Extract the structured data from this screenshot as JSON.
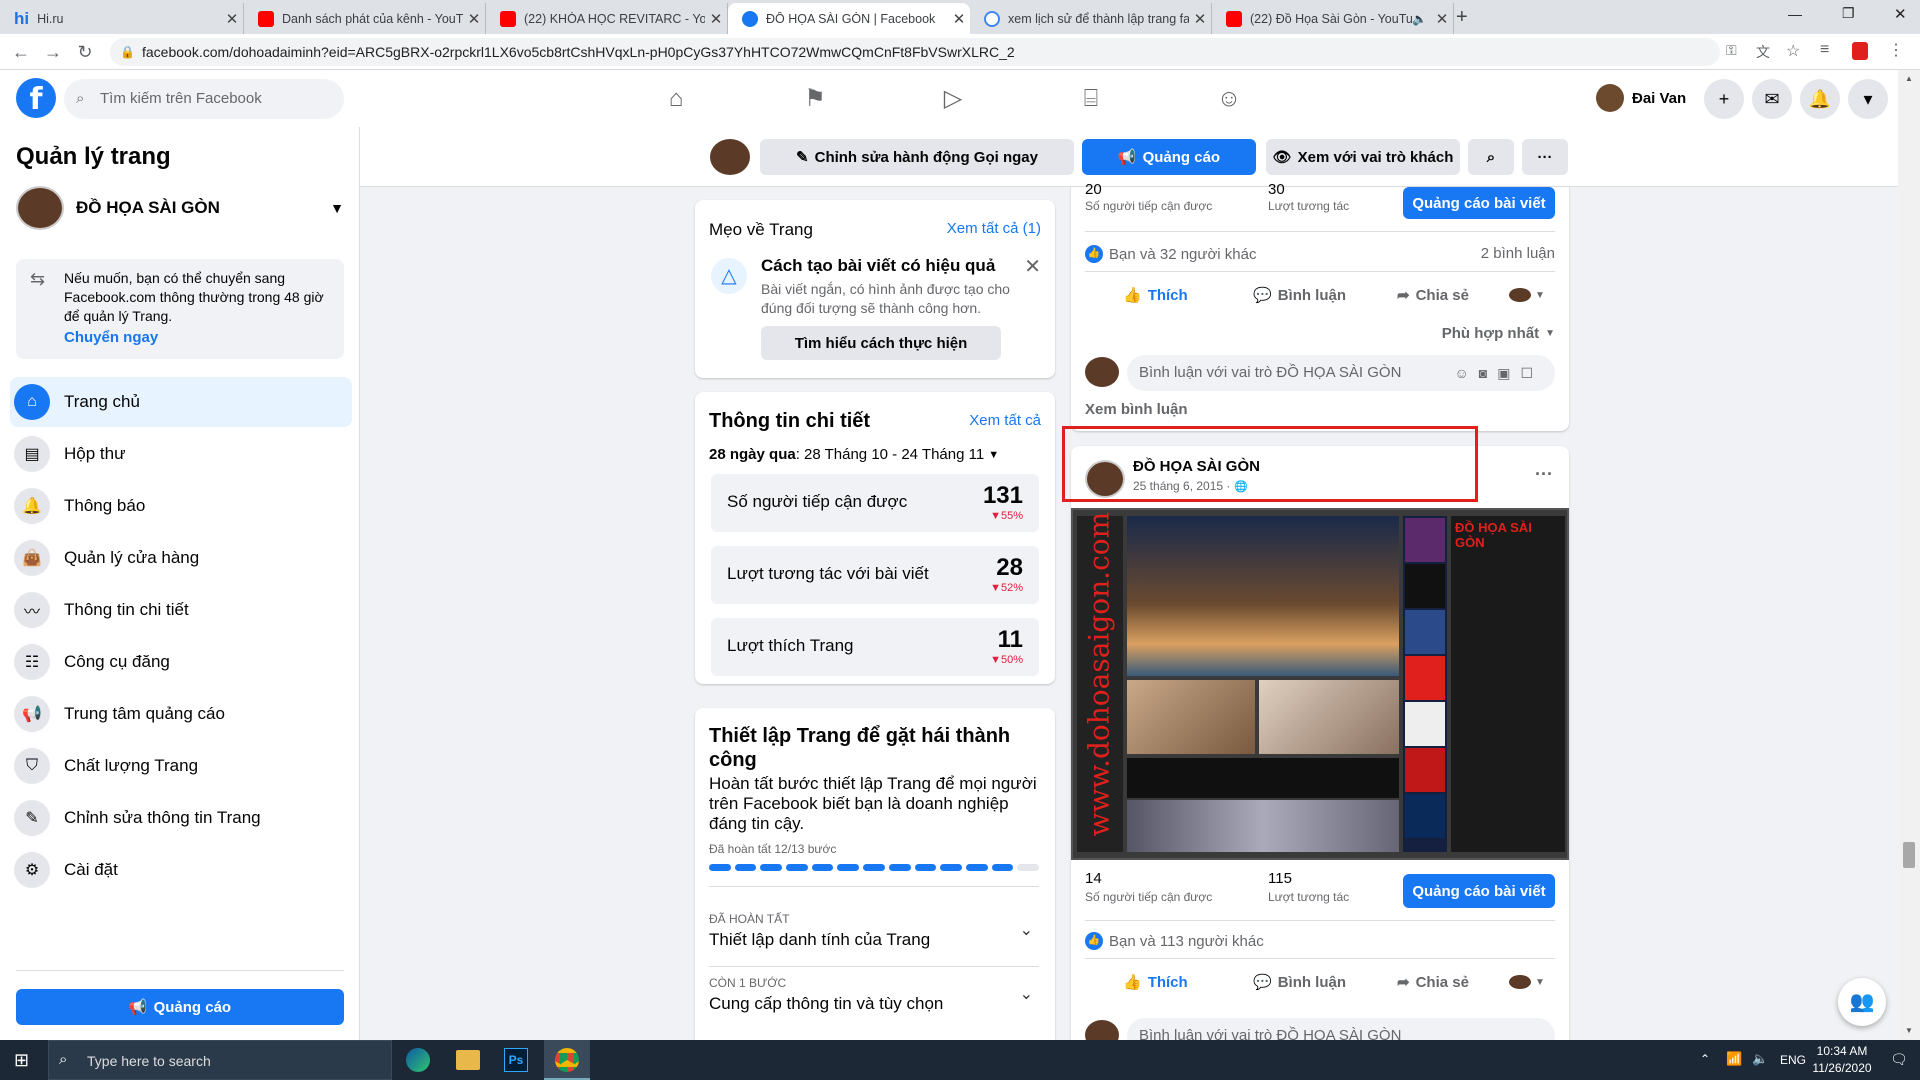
{
  "browser": {
    "tabs": [
      {
        "label": "Hi.ru",
        "favicon_text": "hi"
      },
      {
        "label": "Danh sách phát của kênh - YouTu"
      },
      {
        "label": "(22) KHÓA HỌC REVITARC - YouT"
      },
      {
        "label": "ĐỒ HỌA SÀI GÒN | Facebook"
      },
      {
        "label": "xem lịch sử để thành lập trang fa"
      },
      {
        "label": "(22) Đồ Họa Sài Gòn - YouTu"
      }
    ],
    "url": "facebook.com/dohoadaiminh?eid=ARC5gBRX-o2rpckrl1LX6vo5cb8rtCshHVqxLn-pH0pCyGs37YhHTCO72WmwCQmCnFt8FbVSwrXLRC_2"
  },
  "header": {
    "search_placeholder": "Tìm kiếm trên Facebook",
    "user_name": "Đai Van"
  },
  "sidebar": {
    "title": "Quản lý trang",
    "page_name": "ĐỒ HỌA SÀI GÒN",
    "notice": "Nếu muốn, bạn có thể chuyển sang Facebook.com thông thường trong 48 giờ để quản lý Trang.",
    "notice_link": "Chuyển ngay",
    "items": [
      {
        "label": "Trang chủ"
      },
      {
        "label": "Hộp thư"
      },
      {
        "label": "Thông báo"
      },
      {
        "label": "Quản lý cửa hàng"
      },
      {
        "label": "Thông tin chi tiết"
      },
      {
        "label": "Công cụ đăng"
      },
      {
        "label": "Trung tâm quảng cáo"
      },
      {
        "label": "Chất lượng Trang"
      },
      {
        "label": "Chỉnh sửa thông tin Trang"
      },
      {
        "label": "Cài đặt"
      }
    ],
    "ad_button": "Quảng cáo"
  },
  "pagebar": {
    "edit_action": "Chỉnh sửa hành động Gọi ngay",
    "ad": "Quảng cáo",
    "view_as": "Xem với vai trò khách"
  },
  "tips": {
    "title": "Mẹo về Trang",
    "see_all": "Xem tất cả (1)",
    "tip_title": "Cách tạo bài viết có hiệu quả",
    "tip_body": "Bài viết ngắn, có hình ảnh được tạo cho đúng đối tượng sẽ thành công hơn.",
    "tip_button": "Tìm hiểu cách thực hiện"
  },
  "insights": {
    "title": "Thông tin chi tiết",
    "see_all": "Xem tất cả",
    "range_prefix": "28 ngày qua",
    "range": ": 28 Tháng 10 - 24 Tháng 11",
    "stats": [
      {
        "label": "Số người tiếp cận được",
        "value": "131",
        "change": "55%"
      },
      {
        "label": "Lượt tương tác với bài viết",
        "value": "28",
        "change": "52%"
      },
      {
        "label": "Lượt thích Trang",
        "value": "11",
        "change": "50%"
      }
    ]
  },
  "setup": {
    "title": "Thiết lập Trang để gặt hái thành công",
    "body": "Hoàn tất bước thiết lập Trang để mọi người trên Facebook biết bạn là doanh nghiệp đáng tin cậy.",
    "progress_text": "Đã hoàn tất 12/13 bước",
    "progress_done": 12,
    "progress_total": 13,
    "steps": [
      {
        "status": "ĐÃ HOÀN TẤT",
        "label": "Thiết lập danh tính của Trang"
      },
      {
        "status": "CÒN 1 BƯỚC",
        "label": "Cung cấp thông tin và tùy chọn"
      }
    ]
  },
  "post1": {
    "reach_value": "20",
    "reach_label": "Số người tiếp cận được",
    "engage_value": "30",
    "engage_label": "Lượt tương tác",
    "boost": "Quảng cáo bài viết",
    "likes": "Bạn và 32 người khác",
    "comments": "2 bình luận",
    "like": "Thích",
    "comment": "Bình luận",
    "share": "Chia sẻ",
    "sort": "Phù hợp nhất",
    "comment_placeholder": "Bình luận với vai trò ĐỒ HỌA SÀI GÒN",
    "view_comments": "Xem bình luận"
  },
  "post2": {
    "author": "ĐỒ HỌA SÀI GÒN",
    "date": "25 tháng 6, 2015 ·",
    "image_side_text": "www.dohoasaigon.com",
    "image_brand": "ĐỒ HỌA SÀI GÒN",
    "reach_value": "14",
    "reach_label": "Số người tiếp cận được",
    "engage_value": "115",
    "engage_label": "Lượt tương tác",
    "boost": "Quảng cáo bài viết",
    "likes": "Bạn và 113 người khác",
    "like": "Thích",
    "comment": "Bình luận",
    "share": "Chia sẻ",
    "comment_placeholder": "Bình luận với vai trò ĐỒ HỌA SÀI GÒN"
  },
  "taskbar": {
    "search": "Type here to search",
    "lang": "ENG",
    "time": "10:34 AM",
    "date": "11/26/2020"
  },
  "colors": {
    "fb_blue": "#1877f2",
    "highlight_red": "#e0201c"
  }
}
